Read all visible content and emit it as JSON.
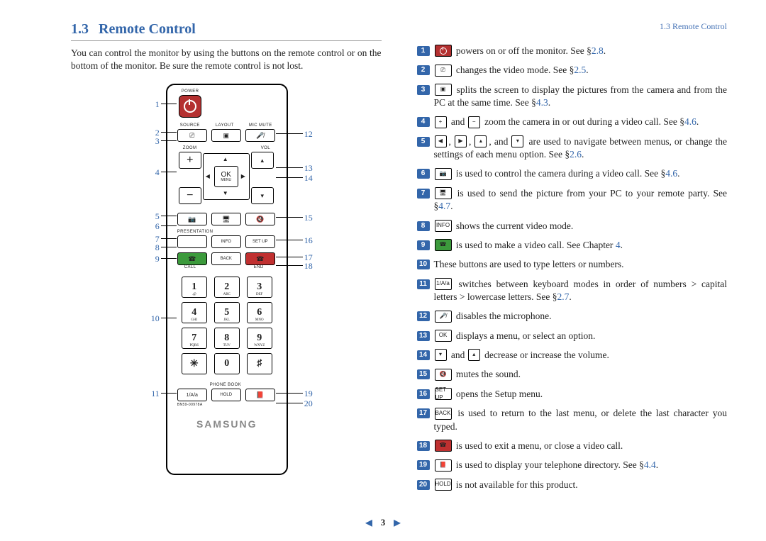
{
  "header": {
    "running": "1.3 Remote Control"
  },
  "section": {
    "num": "1.3",
    "title": "Remote Control"
  },
  "intro": "You can control the monitor by using the buttons on the remote control or on the bottom of the monitor. Be sure the remote control is not lost.",
  "brand": "SAMSUNG",
  "remote_labels": {
    "power": "POWER",
    "source": "SOURCE",
    "layout": "LAYOUT",
    "micmute": "MIC MUTE",
    "zoom": "ZOOM",
    "vol": "VOL",
    "ok": "OK",
    "menu": "MENU",
    "presentation": "PRESENTATION",
    "info": "INFO",
    "setup": "SET UP",
    "call": "CALL",
    "back": "BACK",
    "end": "END",
    "phonebook": "PHONE BOOK",
    "onea": "1/A/a",
    "hold": "HOLD",
    "model": "BN59-00978A"
  },
  "keypad": [
    {
      "k": "1",
      "s": ".@"
    },
    {
      "k": "2",
      "s": "ABC"
    },
    {
      "k": "3",
      "s": "DEF"
    },
    {
      "k": "4",
      "s": "GHI"
    },
    {
      "k": "5",
      "s": "JKL"
    },
    {
      "k": "6",
      "s": "MNO"
    },
    {
      "k": "7",
      "s": "PQRS"
    },
    {
      "k": "8",
      "s": "TUV"
    },
    {
      "k": "9",
      "s": "WXYZ"
    },
    {
      "k": "✳",
      "s": ""
    },
    {
      "k": "0",
      "s": ""
    },
    {
      "k": "♯",
      "s": ""
    }
  ],
  "callouts_left": [
    1,
    2,
    3,
    4,
    5,
    6,
    7,
    8,
    9,
    10,
    11
  ],
  "callouts_right": [
    12,
    13,
    14,
    15,
    16,
    17,
    18,
    19,
    20
  ],
  "desc": [
    {
      "n": 1,
      "icon": {
        "type": "power"
      },
      "text": "powers on or off the monitor. See §",
      "ref": "2.8"
    },
    {
      "n": 2,
      "icon": {
        "type": "box",
        "label": "⎚"
      },
      "text": "changes the video mode. See §",
      "ref": "2.5"
    },
    {
      "n": 3,
      "icon": {
        "type": "box",
        "label": "▣"
      },
      "text": "splits the screen to display the pictures from the camera and from the PC at the same time. See §",
      "ref": "4.3"
    },
    {
      "n": 4,
      "icon": {
        "type": "pair",
        "a": "+",
        "b": "−"
      },
      "mid": " and ",
      "text": "zoom the camera in or out during a video call. See §",
      "ref": "4.6"
    },
    {
      "n": 5,
      "icon": {
        "type": "quad"
      },
      "text": "are used to navigate between menus, or change the settings of each menu option. See §",
      "ref": "2.6",
      "prefix": ", and "
    },
    {
      "n": 6,
      "icon": {
        "type": "box",
        "label": "📷"
      },
      "text": "is used to control the camera during a video call. See §",
      "ref": "4.6"
    },
    {
      "n": 7,
      "icon": {
        "type": "box",
        "label": "🖥"
      },
      "text": "is used to send the picture from your PC to your remote party. See §",
      "ref": "4.7"
    },
    {
      "n": 8,
      "icon": {
        "type": "box",
        "label": "INFO"
      },
      "text": "shows the current video mode."
    },
    {
      "n": 9,
      "icon": {
        "type": "box",
        "label": "☎",
        "cls": "green"
      },
      "text": "is used to make a video call. See Chapter ",
      "ref": "4",
      "refplain": true
    },
    {
      "n": 10,
      "text": "These buttons are used to type letters or numbers."
    },
    {
      "n": 11,
      "icon": {
        "type": "box",
        "label": "1/A/a"
      },
      "text": "switches between keyboard modes in order of numbers > capital letters > lowercase letters. See §",
      "ref": "2.7"
    },
    {
      "n": 12,
      "icon": {
        "type": "box",
        "label": "🎤̸"
      },
      "text": "disables the microphone."
    },
    {
      "n": 13,
      "icon": {
        "type": "box",
        "label": "OK"
      },
      "text": "displays a menu, or select an option."
    },
    {
      "n": 14,
      "icon": {
        "type": "pair",
        "a": "▾",
        "b": "▴"
      },
      "mid": " and ",
      "text": "decrease or increase the volume."
    },
    {
      "n": 15,
      "icon": {
        "type": "box",
        "label": "🔇"
      },
      "text": "mutes the sound."
    },
    {
      "n": 16,
      "icon": {
        "type": "box",
        "label": "SET UP"
      },
      "text": "opens the Setup menu."
    },
    {
      "n": 17,
      "icon": {
        "type": "box",
        "label": "BACK"
      },
      "text": "is used to return to the last menu, or delete the last character you typed."
    },
    {
      "n": 18,
      "icon": {
        "type": "box",
        "label": "☎",
        "cls": "red"
      },
      "text": "is used to exit a menu, or close a video call."
    },
    {
      "n": 19,
      "icon": {
        "type": "box",
        "label": "📕"
      },
      "text": "is used to display your telephone directory. See §",
      "ref": "4.4"
    },
    {
      "n": 20,
      "icon": {
        "type": "box",
        "label": "HOLD"
      },
      "text": "is not available for this product."
    }
  ],
  "pager": {
    "prev": "◀",
    "page": "3",
    "next": "▶"
  }
}
